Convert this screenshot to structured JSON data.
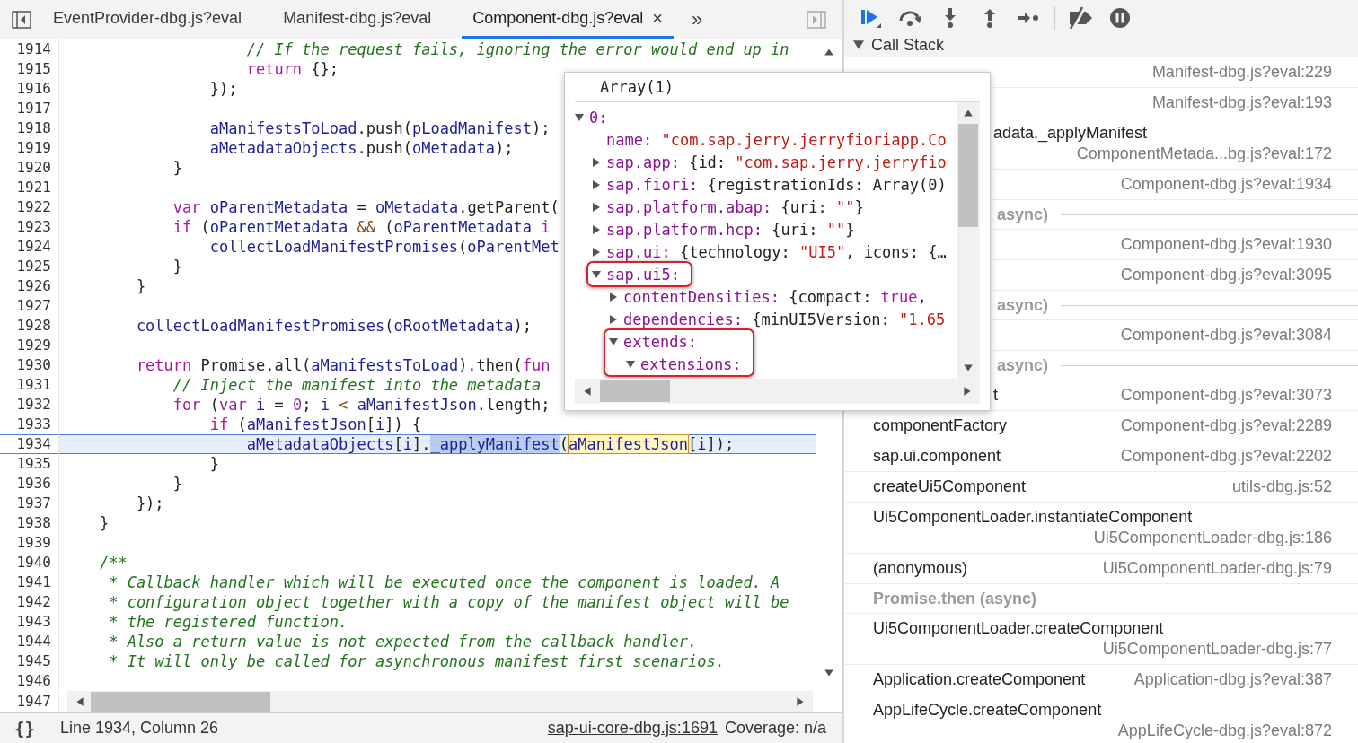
{
  "editor": {
    "tabs": [
      {
        "label": "EventProvider-dbg.js?eval",
        "selected": false
      },
      {
        "label": "Manifest-dbg.js?eval",
        "selected": false
      },
      {
        "label": "Component-dbg.js?eval",
        "selected": true,
        "close": "×"
      }
    ],
    "more_tabs": "»",
    "lines": [
      {
        "number": "1914",
        "current": false,
        "tokens": [
          {
            "kind": "comment",
            "text": "                    // If the request fails, ignoring the error would end up in"
          }
        ]
      },
      {
        "number": "1915",
        "current": false,
        "tokens": [
          {
            "kind": "keyword",
            "text": "                    return"
          },
          {
            "kind": "plain",
            "text": " {};"
          }
        ]
      },
      {
        "number": "1916",
        "current": false,
        "tokens": [
          {
            "kind": "plain",
            "text": "                });"
          }
        ]
      },
      {
        "number": "1917",
        "current": false
      },
      {
        "number": "1918",
        "current": false,
        "tokens": [
          {
            "kind": "variable",
            "text": "                aManifestsToLoad"
          },
          {
            "kind": "plain",
            "text": ".push("
          },
          {
            "kind": "variable",
            "text": "pLoadManifest"
          },
          {
            "kind": "plain",
            "text": ");"
          }
        ]
      },
      {
        "number": "1919",
        "current": false,
        "tokens": [
          {
            "kind": "variable",
            "text": "                aMetadataObjects"
          },
          {
            "kind": "plain",
            "text": ".push("
          },
          {
            "kind": "variable",
            "text": "oMetadata"
          },
          {
            "kind": "plain",
            "text": ");"
          }
        ]
      },
      {
        "number": "1920",
        "current": false,
        "tokens": [
          {
            "kind": "plain",
            "text": "            }"
          }
        ]
      },
      {
        "number": "1921",
        "current": false
      },
      {
        "number": "1922",
        "current": false,
        "tokens": [
          {
            "kind": "keyword",
            "text": "            var"
          },
          {
            "kind": "variable",
            "text": " oParentMetadata"
          },
          {
            "kind": "plain",
            "text": " = "
          },
          {
            "kind": "variable",
            "text": "oMetadata"
          },
          {
            "kind": "plain",
            "text": ".getParent("
          }
        ]
      },
      {
        "number": "1923",
        "current": false,
        "tokens": [
          {
            "kind": "keyword",
            "text": "            if"
          },
          {
            "kind": "plain",
            "text": " ("
          },
          {
            "kind": "variable",
            "text": "oParentMetadata"
          },
          {
            "kind": "operator",
            "text": " &&"
          },
          {
            "kind": "plain",
            "text": " ("
          },
          {
            "kind": "variable",
            "text": "oParentMetadata"
          },
          {
            "kind": "keyword",
            "text": " i"
          }
        ]
      },
      {
        "number": "1924",
        "current": false,
        "tokens": [
          {
            "kind": "variable",
            "text": "                collectLoadManifestPromises"
          },
          {
            "kind": "plain",
            "text": "("
          },
          {
            "kind": "variable",
            "text": "oParentMet"
          }
        ]
      },
      {
        "number": "1925",
        "current": false,
        "tokens": [
          {
            "kind": "plain",
            "text": "            }"
          }
        ]
      },
      {
        "number": "1926",
        "current": false,
        "tokens": [
          {
            "kind": "plain",
            "text": "        }"
          }
        ]
      },
      {
        "number": "1927",
        "current": false
      },
      {
        "number": "1928",
        "current": false,
        "tokens": [
          {
            "kind": "variable",
            "text": "        collectLoadManifestPromises"
          },
          {
            "kind": "plain",
            "text": "("
          },
          {
            "kind": "variable",
            "text": "oRootMetadata"
          },
          {
            "kind": "plain",
            "text": ");"
          }
        ]
      },
      {
        "number": "1929",
        "current": false
      },
      {
        "number": "1930",
        "current": false,
        "tokens": [
          {
            "kind": "keyword",
            "text": "        return"
          },
          {
            "kind": "plain",
            "text": " Promise.all("
          },
          {
            "kind": "variable",
            "text": "aManifestsToLoad"
          },
          {
            "kind": "plain",
            "text": ").then("
          },
          {
            "kind": "keyword",
            "text": "fun"
          }
        ]
      },
      {
        "number": "1931",
        "current": false,
        "tokens": [
          {
            "kind": "comment",
            "text": "            // Inject the manifest into the metadata"
          }
        ]
      },
      {
        "number": "1932",
        "current": false,
        "tokens": [
          {
            "kind": "keyword",
            "text": "            for"
          },
          {
            "kind": "plain",
            "text": " ("
          },
          {
            "kind": "keyword",
            "text": "var"
          },
          {
            "kind": "variable",
            "text": " i"
          },
          {
            "kind": "plain",
            "text": " = "
          },
          {
            "kind": "number",
            "text": "0"
          },
          {
            "kind": "plain",
            "text": "; "
          },
          {
            "kind": "variable",
            "text": "i"
          },
          {
            "kind": "operator",
            "text": " <"
          },
          {
            "kind": "variable",
            "text": " aManifestJson"
          },
          {
            "kind": "plain",
            "text": ".length;"
          }
        ]
      },
      {
        "number": "1933",
        "current": false,
        "tokens": [
          {
            "kind": "keyword",
            "text": "                if"
          },
          {
            "kind": "plain",
            "text": " ("
          },
          {
            "kind": "variable",
            "text": "aManifestJson"
          },
          {
            "kind": "plain",
            "text": "["
          },
          {
            "kind": "variable",
            "text": "i"
          },
          {
            "kind": "plain",
            "text": "]) {"
          }
        ]
      },
      {
        "number": "1934",
        "current": true,
        "tokens": [
          {
            "kind": "variable",
            "text": "                    aMetadataObjects"
          },
          {
            "kind": "plain",
            "text": "["
          },
          {
            "kind": "variable",
            "text": "i"
          },
          {
            "kind": "plain",
            "text": "]."
          },
          {
            "kind": "selection",
            "text": "_applyManifest"
          },
          {
            "kind": "plain",
            "text": "("
          },
          {
            "kind": "hover",
            "text": "aManifestJson"
          },
          {
            "kind": "plain",
            "text": "["
          },
          {
            "kind": "variable",
            "text": "i"
          },
          {
            "kind": "plain",
            "text": "]);"
          }
        ]
      },
      {
        "number": "1935",
        "current": false,
        "tokens": [
          {
            "kind": "plain",
            "text": "                }"
          }
        ]
      },
      {
        "number": "1936",
        "current": false,
        "tokens": [
          {
            "kind": "plain",
            "text": "            }"
          }
        ]
      },
      {
        "number": "1937",
        "current": false,
        "tokens": [
          {
            "kind": "plain",
            "text": "        });"
          }
        ]
      },
      {
        "number": "1938",
        "current": false,
        "tokens": [
          {
            "kind": "plain",
            "text": "    }"
          }
        ]
      },
      {
        "number": "1939",
        "current": false
      },
      {
        "number": "1940",
        "current": false,
        "tokens": [
          {
            "kind": "comment",
            "text": "    /**"
          }
        ]
      },
      {
        "number": "1941",
        "current": false,
        "tokens": [
          {
            "kind": "comment",
            "text": "     * Callback handler which will be executed once the component is loaded. A"
          }
        ]
      },
      {
        "number": "1942",
        "current": false,
        "tokens": [
          {
            "kind": "comment",
            "text": "     * configuration object together with a copy of the manifest object will be"
          }
        ]
      },
      {
        "number": "1943",
        "current": false,
        "tokens": [
          {
            "kind": "comment",
            "text": "     * the registered function."
          }
        ]
      },
      {
        "number": "1944",
        "current": false,
        "tokens": [
          {
            "kind": "comment",
            "text": "     * Also a return value is not expected from the callback handler."
          }
        ]
      },
      {
        "number": "1945",
        "current": false,
        "tokens": [
          {
            "kind": "comment",
            "text": "     * It will only be called for asynchronous manifest first scenarios."
          }
        ]
      },
      {
        "number": "1946",
        "current": false
      }
    ],
    "last_line_number": "1947"
  },
  "status_bar": {
    "format_button": "{}",
    "position": "Line 1934, Column 26",
    "source_link": "sap-ui-core-dbg.js:1691",
    "coverage": "Coverage: n/a"
  },
  "popover": {
    "title": "Array(1)",
    "tree": [
      {
        "key": "0:",
        "expanded": true,
        "children": [
          {
            "key": "name:",
            "value": [
              {
                "kind": "string",
                "text": "\"com.sap.jerry.jerryfioriapp.Co"
              }
            ]
          },
          {
            "key": "sap.app:",
            "expanded": false,
            "value": [
              {
                "kind": "plain",
                "text": "{id: "
              },
              {
                "kind": "string",
                "text": "\"com.sap.jerry.jerryfio"
              }
            ]
          },
          {
            "key": "sap.fiori:",
            "expanded": false,
            "value": [
              {
                "kind": "plain",
                "text": "{registrationIds: Array(0)"
              }
            ]
          },
          {
            "key": "sap.platform.abap:",
            "expanded": false,
            "value": [
              {
                "kind": "plain",
                "text": "{uri: "
              },
              {
                "kind": "string",
                "text": "\"\""
              },
              {
                "kind": "plain",
                "text": "}"
              }
            ]
          },
          {
            "key": "sap.platform.hcp:",
            "expanded": false,
            "value": [
              {
                "kind": "plain",
                "text": "{uri: "
              },
              {
                "kind": "string",
                "text": "\"\""
              },
              {
                "kind": "plain",
                "text": "}"
              }
            ]
          },
          {
            "key": "sap.ui:",
            "expanded": false,
            "value": [
              {
                "kind": "plain",
                "text": "{technology: "
              },
              {
                "kind": "string",
                "text": "\"UI5\""
              },
              {
                "kind": "plain",
                "text": ", icons: {…"
              }
            ]
          },
          {
            "key": "sap.ui5:",
            "expanded": true,
            "boxed": true,
            "box_includes_children": false,
            "children": [
              {
                "key": "contentDensities:",
                "expanded": false,
                "value": [
                  {
                    "kind": "plain",
                    "text": "{compact: "
                  },
                  {
                    "kind": "keyword",
                    "text": "true"
                  },
                  {
                    "kind": "plain",
                    "text": ","
                  }
                ]
              },
              {
                "key": "dependencies:",
                "expanded": false,
                "value": [
                  {
                    "kind": "plain",
                    "text": "{minUI5Version: "
                  },
                  {
                    "kind": "string",
                    "text": "\"1.65"
                  }
                ]
              },
              {
                "key": "extends:",
                "expanded": true,
                "boxed": true,
                "box_includes_children": true,
                "children": [
                  {
                    "key": "extensions:",
                    "expanded": true
                  }
                ]
              }
            ]
          }
        ]
      }
    ]
  },
  "debugger": {
    "call_stack": {
      "title": "Call Stack",
      "expanded": true,
      "frames": [
        {
          "kind": "frame",
          "location": "Manifest-dbg.js?eval:229"
        },
        {
          "kind": "frame",
          "location": "Manifest-dbg.js?eval:193"
        },
        {
          "kind": "frame",
          "clipped": true,
          "name": "adata._applyManifest",
          "location": "ComponentMetada...bg.js?eval:172"
        },
        {
          "kind": "frame",
          "location": "Component-dbg.js?eval:1934"
        },
        {
          "kind": "separator",
          "clipped": true,
          "label": "async)"
        },
        {
          "kind": "frame",
          "location": "Component-dbg.js?eval:1930"
        },
        {
          "kind": "frame",
          "location": "Component-dbg.js?eval:3095"
        },
        {
          "kind": "separator",
          "clipped": true,
          "label": "async)"
        },
        {
          "kind": "frame",
          "location": "Component-dbg.js?eval:3084"
        },
        {
          "kind": "separator",
          "clipped": true,
          "label": "async)"
        },
        {
          "kind": "frame",
          "clipped": true,
          "name": "t",
          "location": "Component-dbg.js?eval:3073"
        },
        {
          "kind": "frame",
          "clipped": false,
          "name": "componentFactory",
          "location": "Component-dbg.js?eval:2289"
        },
        {
          "kind": "frame",
          "clipped": false,
          "name": "sap.ui.component",
          "location": "Component-dbg.js?eval:2202"
        },
        {
          "kind": "frame",
          "clipped": false,
          "name": "createUi5Component",
          "location": "utils-dbg.js:52"
        },
        {
          "kind": "frame",
          "clipped": false,
          "name": "Ui5ComponentLoader.instantiateComponent",
          "location": "Ui5ComponentLoader-dbg.js:186"
        },
        {
          "kind": "frame",
          "clipped": false,
          "name": "(anonymous)",
          "location": "Ui5ComponentLoader-dbg.js:79"
        },
        {
          "kind": "separator",
          "label": "Promise.then (async)"
        },
        {
          "kind": "frame",
          "clipped": false,
          "name": "Ui5ComponentLoader.createComponent",
          "location": "Ui5ComponentLoader-dbg.js:77"
        },
        {
          "kind": "frame",
          "clipped": false,
          "name": "Application.createComponent",
          "location": "Application-dbg.js?eval:387"
        },
        {
          "kind": "frame",
          "clipped": false,
          "name": "AppLifeCycle.createComponent",
          "location": "AppLifeCycle-dbg.js?eval:872"
        }
      ]
    }
  }
}
